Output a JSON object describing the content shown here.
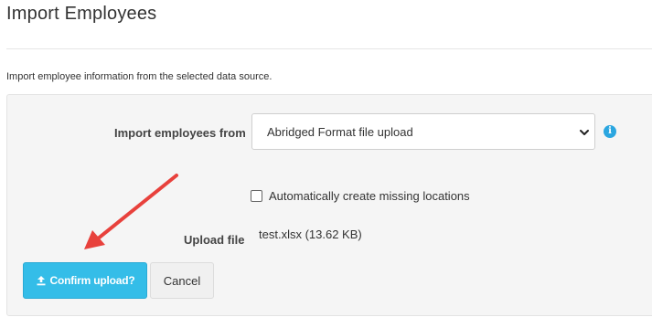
{
  "page": {
    "title": "Import Employees",
    "description": "Import employee information from the selected data source."
  },
  "form": {
    "import_from_label": "Import employees from",
    "import_from_value": "Abridged Format file upload",
    "info_icon": "i",
    "auto_create_locations_label": "Automatically create missing locations",
    "auto_create_locations_checked": false,
    "upload_file_label": "Upload file",
    "upload_file_value": "test.xlsx (13.62 KB)"
  },
  "actions": {
    "confirm_label": "Confirm upload?",
    "cancel_label": "Cancel"
  },
  "icons": {
    "upload": "upload-icon",
    "info": "info-icon",
    "chevron": "chevron-down-icon",
    "annotation": "red-arrow"
  },
  "colors": {
    "primary": "#34bde8",
    "info": "#2ba6e0",
    "annotation": "#e8413c",
    "panel": "#f5f5f5"
  }
}
